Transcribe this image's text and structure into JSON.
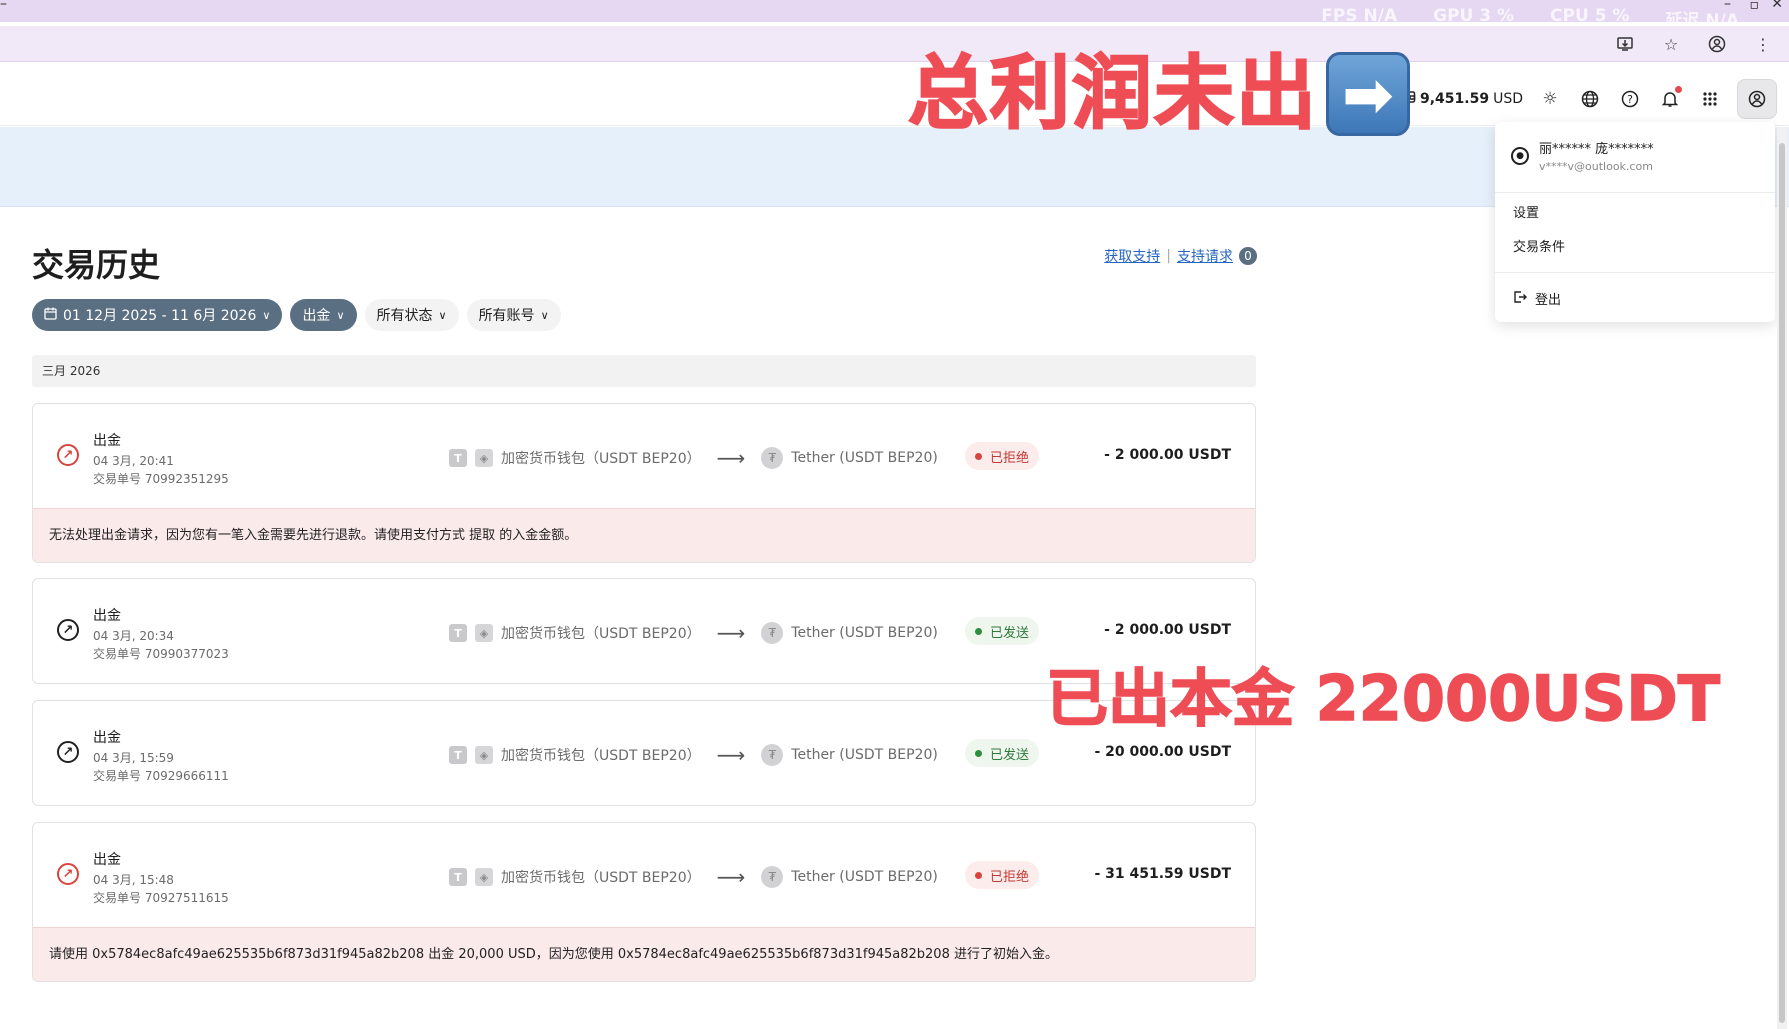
{
  "chrome": {
    "overlay_stats": [
      "FPS N/A",
      "GPU 3 %",
      "CPU 5 %",
      "延迟 N/A"
    ],
    "address_icons": [
      "install-icon",
      "star-icon",
      "profile-icon",
      "menu-icon"
    ]
  },
  "header": {
    "balance": "9,451.59",
    "currency": "USD",
    "icons": [
      "sun-icon",
      "globe-icon",
      "help-icon",
      "bell-icon",
      "apps-icon",
      "account-icon"
    ]
  },
  "annotations": {
    "top": "总利润未出",
    "arrow": "➡",
    "mid": "已出本金 22000USDT"
  },
  "page": {
    "title": "交易历史",
    "support_link": "获取支持",
    "sep": "|",
    "requests_link": "支持请求",
    "requests_count": "0"
  },
  "filters": {
    "date_range": "01 12月 2025 - 11 6月 2026",
    "type": "出金",
    "status": "所有状态",
    "account": "所有账号"
  },
  "month_label": "三月 2026",
  "transactions": [
    {
      "title": "出金",
      "date": "04 3月, 20:41",
      "id": "交易单号 70992351295",
      "from": "加密货币钱包（USDT BEP20）",
      "to": "Tether (USDT BEP20)",
      "status": "已拒绝",
      "amount": "- 2 000.00 USDT",
      "note": "无法处理出金请求，因为您有一笔入金需要先进行退款。请使用支付方式 提取 的入金金额。"
    },
    {
      "title": "出金",
      "date": "04 3月, 20:34",
      "id": "交易单号 70990377023",
      "from": "加密货币钱包（USDT BEP20）",
      "to": "Tether (USDT BEP20)",
      "status": "已发送",
      "amount": "- 2 000.00 USDT",
      "note": ""
    },
    {
      "title": "出金",
      "date": "04 3月, 15:59",
      "id": "交易单号 70929666111",
      "from": "加密货币钱包（USDT BEP20）",
      "to": "Tether (USDT BEP20)",
      "status": "已发送",
      "amount": "- 20 000.00 USDT",
      "note": ""
    },
    {
      "title": "出金",
      "date": "04 3月, 15:48",
      "id": "交易单号 70927511615",
      "from": "加密货币钱包（USDT BEP20）",
      "to": "Tether (USDT BEP20)",
      "status": "已拒绝",
      "amount": "- 31 451.59 USDT",
      "note": "请使用 0x5784ec8afc49ae625535b6f873d31f945a82b208 出金 20,000 USD，因为您使用 0x5784ec8afc49ae625535b6f873d31f945a82b208 进行了初始入金。"
    }
  ],
  "dropdown": {
    "name": "丽****** 庞*******",
    "email": "v****v@outlook.com",
    "settings": "设置",
    "terms": "交易条件",
    "logout": "登出"
  }
}
